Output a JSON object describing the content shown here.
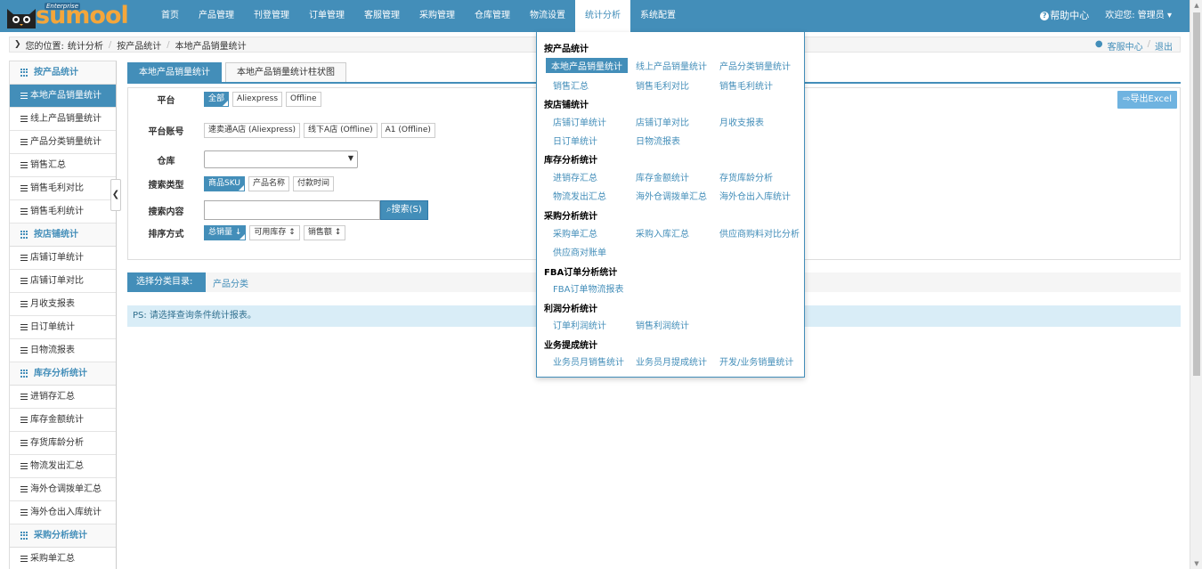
{
  "brand": {
    "name": "sumool",
    "edition": "Enterprise"
  },
  "nav": [
    "首页",
    "产品管理",
    "刊登管理",
    "订单管理",
    "客服管理",
    "采购管理",
    "仓库管理",
    "物流设置",
    "统计分析",
    "系统配置"
  ],
  "header_right": {
    "help": "帮助中心",
    "welcome": "欢迎您: 管理员"
  },
  "breadcrumb": {
    "prefix": "您的位置:",
    "items": [
      "统计分析",
      "按产品统计",
      "本地产品销量统计"
    ],
    "service": "客服中心",
    "logout": "退出"
  },
  "sidebar": {
    "sections": [
      {
        "title": "按产品统计",
        "items": [
          "本地产品销量统计",
          "线上产品销量统计",
          "产品分类销量统计",
          "销售汇总",
          "销售毛利对比",
          "销售毛利统计"
        ]
      },
      {
        "title": "按店铺统计",
        "items": [
          "店铺订单统计",
          "店铺订单对比",
          "月收支报表",
          "日订单统计",
          "日物流报表"
        ]
      },
      {
        "title": "库存分析统计",
        "items": [
          "进销存汇总",
          "库存金额统计",
          "存货库龄分析",
          "物流发出汇总",
          "海外仓调拨单汇总",
          "海外仓出入库统计"
        ]
      },
      {
        "title": "采购分析统计",
        "items": [
          "采购单汇总"
        ]
      }
    ]
  },
  "tabs": [
    "本地产品销量统计",
    "本地产品销量统计柱状图"
  ],
  "filters": {
    "platform_label": "平台",
    "platforms": [
      "全部",
      "Aliexpress",
      "Offline"
    ],
    "account_label": "平台账号",
    "accounts": [
      "速卖通A店 (Aliexpress)",
      "线下A店 (Offline)",
      "A1 (Offline)"
    ],
    "warehouse_label": "仓库",
    "search_type_label": "搜索类型",
    "search_types": [
      "商品SKU",
      "产品名称",
      "付款时间"
    ],
    "search_content_label": "搜索内容",
    "search_button": "搜索(S)",
    "sort_label": "排序方式",
    "sorts": [
      "总销量",
      "可用库存",
      "销售额"
    ],
    "export_button": "导出Excel"
  },
  "category": {
    "label": "选择分类目录:",
    "value": "产品分类"
  },
  "ps_text": "PS: 请选择查询条件统计报表。",
  "mega_menu": {
    "groups": [
      {
        "title": "按产品统计",
        "links": [
          "本地产品销量统计",
          "线上产品销量统计",
          "产品分类销量统计",
          "销售汇总",
          "销售毛利对比",
          "销售毛利统计"
        ]
      },
      {
        "title": "按店铺统计",
        "links": [
          "店铺订单统计",
          "店铺订单对比",
          "月收支报表",
          "日订单统计",
          "日物流报表"
        ]
      },
      {
        "title": "库存分析统计",
        "links": [
          "进销存汇总",
          "库存金额统计",
          "存货库龄分析",
          "物流发出汇总",
          "海外仓调拨单汇总",
          "海外仓出入库统计"
        ]
      },
      {
        "title": "采购分析统计",
        "links": [
          "采购单汇总",
          "采购入库汇总",
          "供应商购料对比分析",
          "供应商对账单"
        ]
      },
      {
        "title": "FBA订单分析统计",
        "links": [
          "FBA订单物流报表"
        ]
      },
      {
        "title": "利润分析统计",
        "links": [
          "订单利润统计",
          "销售利润统计"
        ]
      },
      {
        "title": "业务提成统计",
        "links": [
          "业务员月销售统计",
          "业务员月提成统计",
          "开发/业务销量统计"
        ]
      }
    ]
  },
  "colors": {
    "primary": "#438eb9",
    "logo": "#f4a63b",
    "info_bg": "#d9edf7"
  }
}
